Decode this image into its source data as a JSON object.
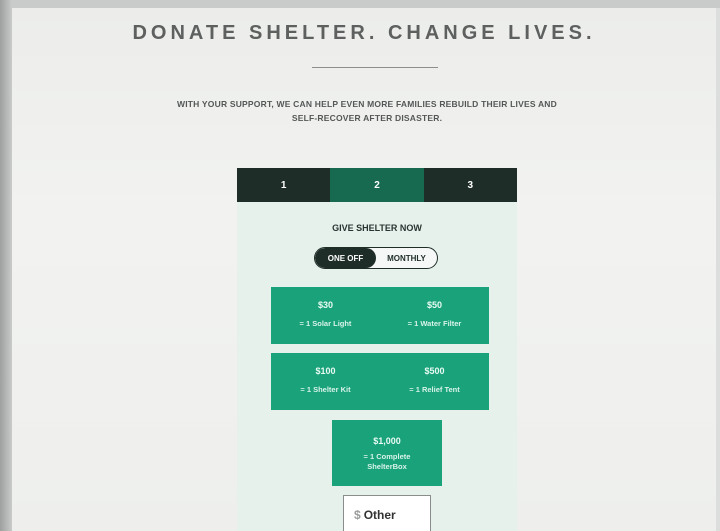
{
  "page": {
    "title": "DONATE SHELTER. CHANGE LIVES.",
    "subtitle_line1": "WITH YOUR SUPPORT, WE CAN HELP EVEN MORE FAMILIES REBUILD THEIR LIVES AND",
    "subtitle_line2": "SELF-RECOVER AFTER DISASTER."
  },
  "form": {
    "steps": [
      "1",
      "2",
      "3"
    ],
    "active_step": "2",
    "heading": "GIVE SHELTER NOW",
    "frequency": {
      "options": [
        "ONE OFF",
        "MONTHLY"
      ],
      "selected": "ONE OFF"
    },
    "amounts": [
      {
        "value": "$30",
        "desc": "= 1 Solar Light"
      },
      {
        "value": "$50",
        "desc": "= 1 Water Filter"
      },
      {
        "value": "$100",
        "desc": "= 1 Shelter Kit"
      },
      {
        "value": "$500",
        "desc": "= 1 Relief Tent"
      },
      {
        "value": "$1,000",
        "desc": "= 1 Complete ShelterBox"
      }
    ],
    "other": {
      "currency": "$",
      "placeholder": "Other"
    }
  },
  "colors": {
    "dark": "#1f2d28",
    "accent": "#17694f",
    "tile": "#1aa27b"
  }
}
